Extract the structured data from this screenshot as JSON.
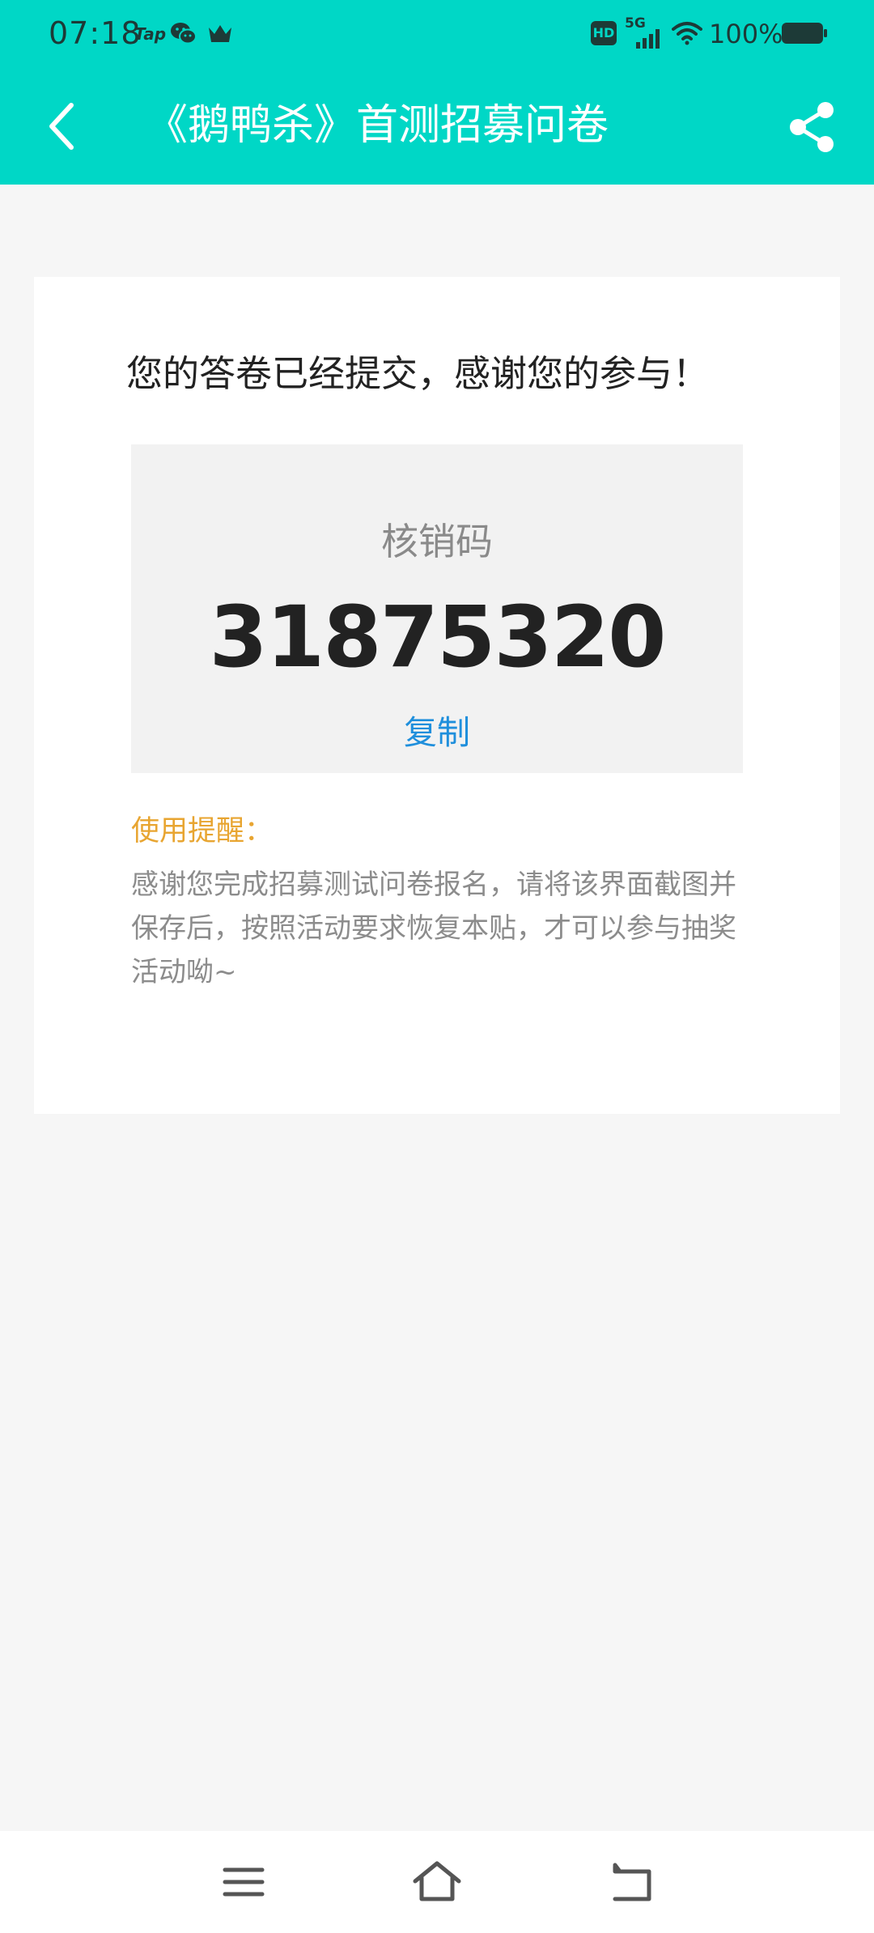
{
  "status_bar": {
    "time": "07:18",
    "battery_percent": "100%",
    "icons": [
      "tap-app-icon",
      "wechat-icon",
      "crown-app-icon",
      "hd-icon",
      "signal-5g-icon",
      "wifi-icon",
      "battery-icon"
    ],
    "hd_label": "HD",
    "network_label": "5G",
    "tap_label": "Tap"
  },
  "app_bar": {
    "title": "《鹅鸭杀》首测招募问卷",
    "back_icon": "chevron-left-icon",
    "share_icon": "share-icon",
    "background_color": "#00d7c6"
  },
  "result": {
    "message": "您的答卷已经提交，感谢您的参与！",
    "code_label": "核销码",
    "code_value": "31875320",
    "copy_label": "复制",
    "tip_title": "使用提醒：",
    "tip_body": "感谢您完成招募测试问卷报名，请将该界面截图并保存后，按照活动要求恢复本贴，才可以参与抽奖活动呦~",
    "copy_color": "#1f8fdc",
    "tip_title_color": "#e8a531"
  },
  "nav_bar": {
    "icons": [
      "menu-icon",
      "home-icon",
      "back-icon"
    ]
  }
}
